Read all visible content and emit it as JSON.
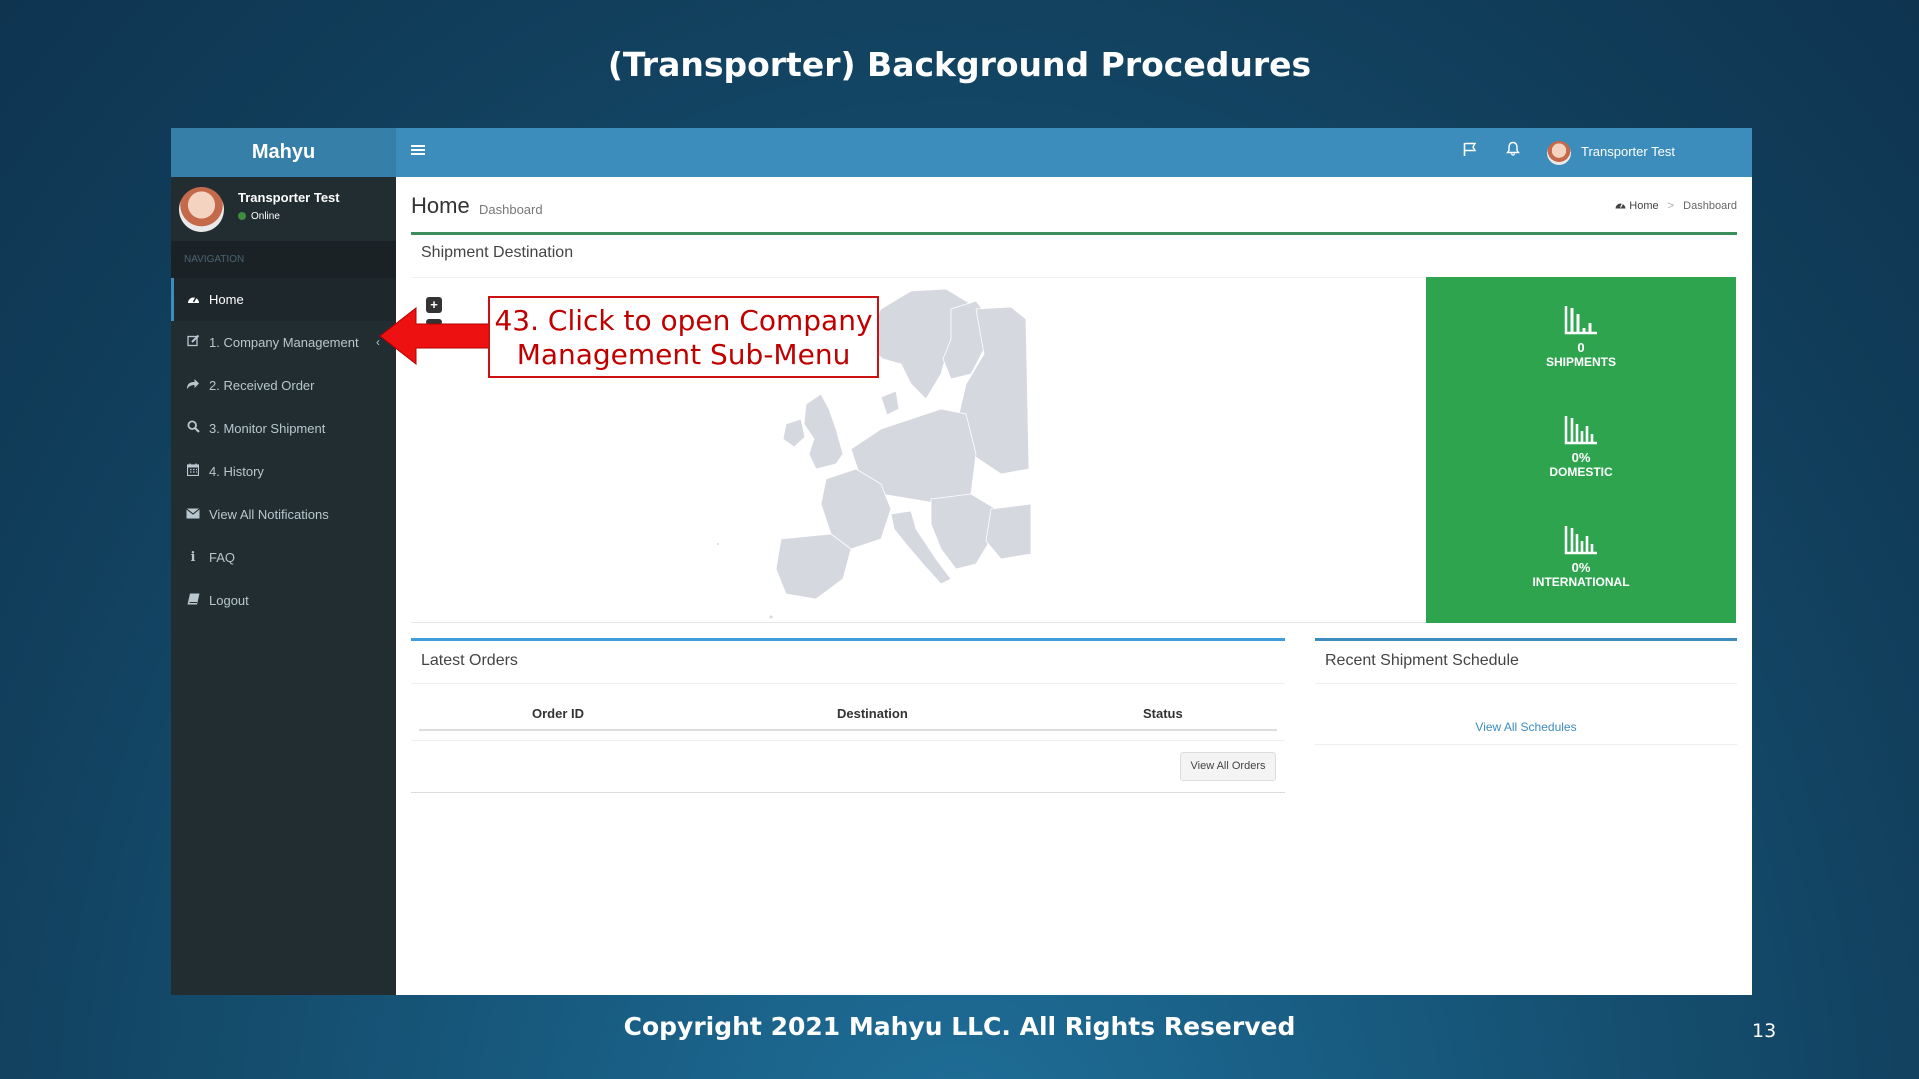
{
  "slide": {
    "title": "(Transporter) Background Procedures",
    "footer": "Copyright 2021 Mahyu LLC. All Rights Reserved",
    "page_number": "13"
  },
  "app": {
    "brand": "Mahyu",
    "user": {
      "name": "Transporter Test",
      "status": "Online"
    },
    "nav_header": "NAVIGATION",
    "menu": [
      {
        "label": "Home",
        "icon": "dashboard-icon"
      },
      {
        "label": "1. Company Management",
        "icon": "edit-icon"
      },
      {
        "label": "2. Received Order",
        "icon": "share-icon"
      },
      {
        "label": "3. Monitor Shipment",
        "icon": "search-icon"
      },
      {
        "label": "4. History",
        "icon": "calendar-icon"
      },
      {
        "label": "View All Notifications",
        "icon": "envelope-icon"
      },
      {
        "label": "FAQ",
        "icon": "info-icon"
      },
      {
        "label": "Logout",
        "icon": "book-icon"
      }
    ]
  },
  "topbar": {
    "user_name": "Transporter Test"
  },
  "content": {
    "page_title": "Home",
    "page_subtitle": "Dashboard",
    "breadcrumb": {
      "home": "Home",
      "current": "Dashboard"
    },
    "shipment_box": {
      "title": "Shipment Destination",
      "zoom_in": "+",
      "stats": [
        {
          "value": "0",
          "label": "SHIPMENTS"
        },
        {
          "value": "0%",
          "label": "DOMESTIC"
        },
        {
          "value": "0%",
          "label": "INTERNATIONAL"
        }
      ]
    },
    "orders_box": {
      "title": "Latest Orders",
      "columns": [
        "Order ID",
        "Destination",
        "Status"
      ],
      "button": "View All Orders"
    },
    "schedule_box": {
      "title": "Recent Shipment Schedule",
      "link": "View All Schedules"
    }
  },
  "callout": {
    "line1": "43. Click to open Company",
    "line2": "Management  Sub-Menu"
  },
  "colors": {
    "accent": "#3c8dbc",
    "sidebar": "#222d32",
    "stats_green": "#2ea44f",
    "callout_red": "#cc1111"
  }
}
